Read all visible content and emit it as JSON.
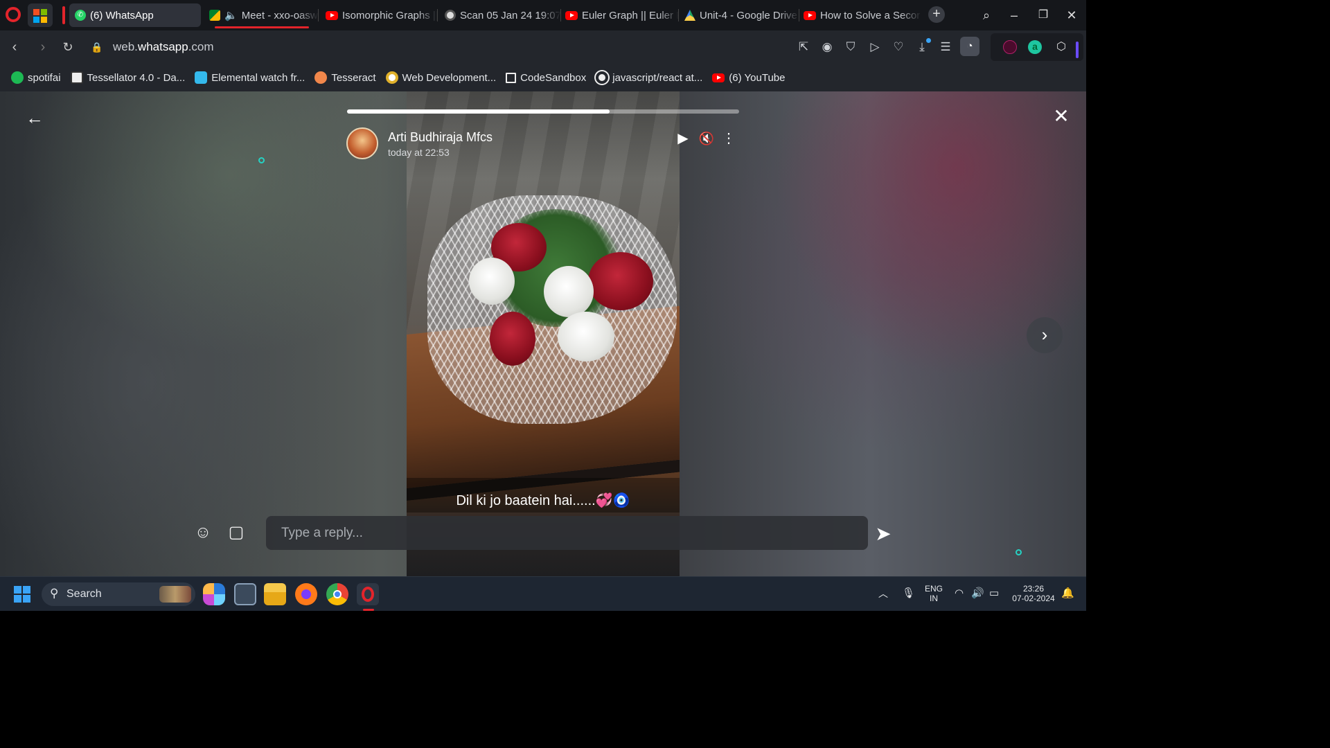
{
  "tabs": [
    {
      "label": "(6) WhatsApp",
      "active": true
    },
    {
      "label": "Meet - xxo-oasw-",
      "audio": true
    },
    {
      "label": "Isomorphic Graphs ||"
    },
    {
      "label": "Scan 05 Jan 24 19:07"
    },
    {
      "label": "Euler Graph || Euler P"
    },
    {
      "label": "Unit-4 - Google Drive"
    },
    {
      "label": "How to Solve a Secor"
    }
  ],
  "address": {
    "prefix": "web.",
    "domain": "whatsapp",
    "suffix": ".com"
  },
  "bookmarks": [
    {
      "label": "spotifai"
    },
    {
      "label": "Tessellator 4.0 - Da..."
    },
    {
      "label": "Elemental watch fr..."
    },
    {
      "label": "Tesseract"
    },
    {
      "label": "Web Development..."
    },
    {
      "label": "CodeSandbox"
    },
    {
      "label": "javascript/react at..."
    },
    {
      "label": "(6) YouTube"
    }
  ],
  "status": {
    "poster_name": "Arti Budhiraja Mfcs",
    "posted_time": "today at 22:53",
    "progress_fraction": 0.67,
    "caption": "Dil ki jo baatein hai......💞🧿",
    "reply_placeholder": "Type a reply..."
  },
  "taskbar": {
    "search_label": "Search",
    "lang_top": "ENG",
    "lang_bottom": "IN",
    "time": "23:26",
    "date": "07-02-2024"
  },
  "colors": {
    "whatsapp_green": "#25d366",
    "opera_red": "#e3242b",
    "accent_teal": "#25d3c4"
  }
}
